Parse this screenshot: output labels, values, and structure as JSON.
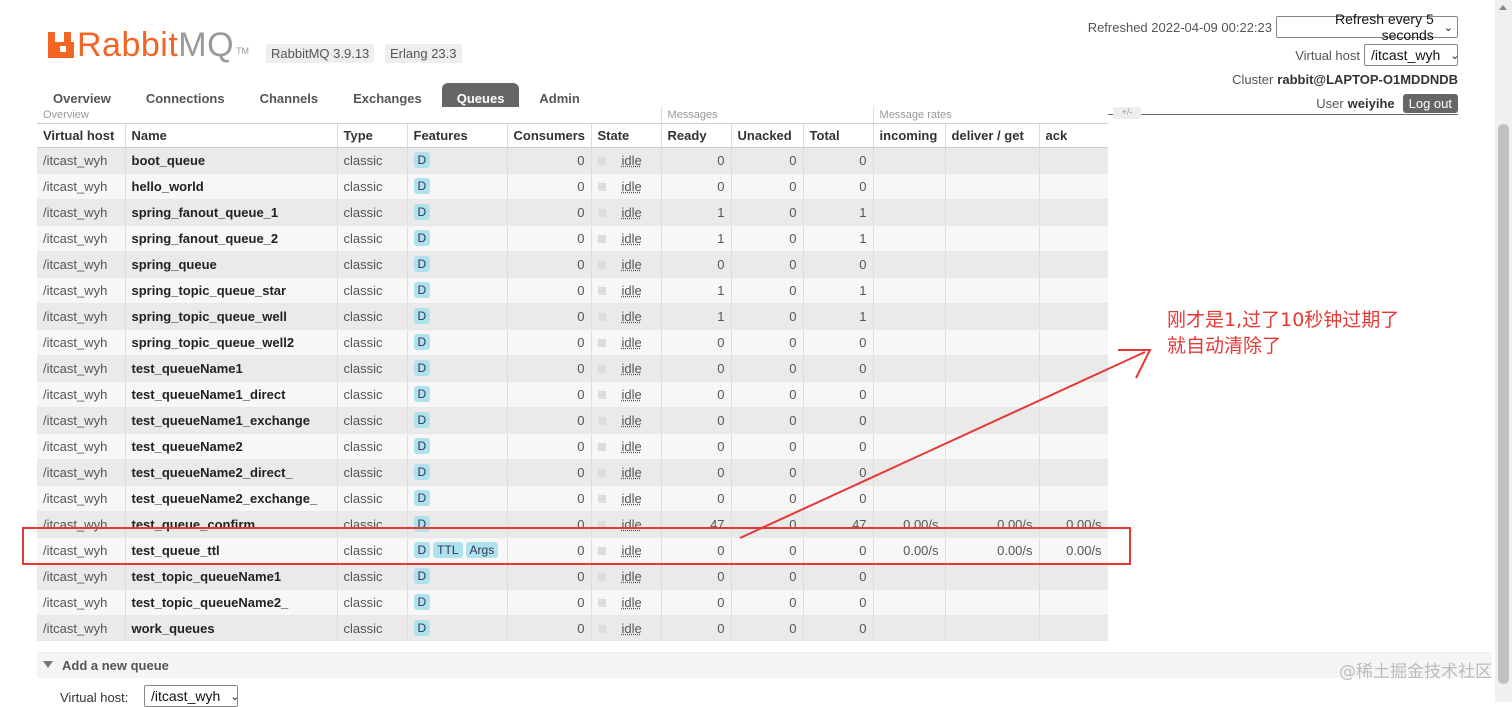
{
  "header": {
    "brand_rabbit": "Rabbit",
    "brand_mq": "MQ",
    "brand_tm": "TM",
    "rabbitmq_version": "RabbitMQ 3.9.13",
    "erlang_version": "Erlang 23.3",
    "refreshed": "Refreshed 2022-04-09 00:22:23",
    "refresh_interval": "Refresh every 5 seconds",
    "virtual_host_label": "Virtual host",
    "virtual_host_value": "/itcast_wyh",
    "cluster_label": "Cluster",
    "cluster_value": "rabbit@LAPTOP-O1MDDNDB",
    "user_label": "User",
    "user_value": "weiyihe",
    "logout_label": "Log out"
  },
  "nav": {
    "tabs": [
      {
        "label": "Overview"
      },
      {
        "label": "Connections"
      },
      {
        "label": "Channels"
      },
      {
        "label": "Exchanges"
      },
      {
        "label": "Queues",
        "active": true
      },
      {
        "label": "Admin"
      }
    ]
  },
  "table": {
    "group_headers": {
      "overview": "Overview",
      "messages": "Messages",
      "message_rates": "Message rates"
    },
    "columns": [
      "Virtual host",
      "Name",
      "Type",
      "Features",
      "Consumers",
      "State",
      "Ready",
      "Unacked",
      "Total",
      "incoming",
      "deliver / get",
      "ack"
    ],
    "rows": [
      {
        "vhost": "/itcast_wyh",
        "name": "boot_queue",
        "type": "classic",
        "features": [
          "D"
        ],
        "consumers": "0",
        "state": "idle",
        "ready": "0",
        "unacked": "0",
        "total": "0",
        "incoming": "",
        "deliver": "",
        "ack": ""
      },
      {
        "vhost": "/itcast_wyh",
        "name": "hello_world",
        "type": "classic",
        "features": [
          "D"
        ],
        "consumers": "0",
        "state": "idle",
        "ready": "0",
        "unacked": "0",
        "total": "0",
        "incoming": "",
        "deliver": "",
        "ack": ""
      },
      {
        "vhost": "/itcast_wyh",
        "name": "spring_fanout_queue_1",
        "type": "classic",
        "features": [
          "D"
        ],
        "consumers": "0",
        "state": "idle",
        "ready": "1",
        "unacked": "0",
        "total": "1",
        "incoming": "",
        "deliver": "",
        "ack": ""
      },
      {
        "vhost": "/itcast_wyh",
        "name": "spring_fanout_queue_2",
        "type": "classic",
        "features": [
          "D"
        ],
        "consumers": "0",
        "state": "idle",
        "ready": "1",
        "unacked": "0",
        "total": "1",
        "incoming": "",
        "deliver": "",
        "ack": ""
      },
      {
        "vhost": "/itcast_wyh",
        "name": "spring_queue",
        "type": "classic",
        "features": [
          "D"
        ],
        "consumers": "0",
        "state": "idle",
        "ready": "0",
        "unacked": "0",
        "total": "0",
        "incoming": "",
        "deliver": "",
        "ack": ""
      },
      {
        "vhost": "/itcast_wyh",
        "name": "spring_topic_queue_star",
        "type": "classic",
        "features": [
          "D"
        ],
        "consumers": "0",
        "state": "idle",
        "ready": "1",
        "unacked": "0",
        "total": "1",
        "incoming": "",
        "deliver": "",
        "ack": ""
      },
      {
        "vhost": "/itcast_wyh",
        "name": "spring_topic_queue_well",
        "type": "classic",
        "features": [
          "D"
        ],
        "consumers": "0",
        "state": "idle",
        "ready": "1",
        "unacked": "0",
        "total": "1",
        "incoming": "",
        "deliver": "",
        "ack": ""
      },
      {
        "vhost": "/itcast_wyh",
        "name": "spring_topic_queue_well2",
        "type": "classic",
        "features": [
          "D"
        ],
        "consumers": "0",
        "state": "idle",
        "ready": "0",
        "unacked": "0",
        "total": "0",
        "incoming": "",
        "deliver": "",
        "ack": ""
      },
      {
        "vhost": "/itcast_wyh",
        "name": "test_queueName1",
        "type": "classic",
        "features": [
          "D"
        ],
        "consumers": "0",
        "state": "idle",
        "ready": "0",
        "unacked": "0",
        "total": "0",
        "incoming": "",
        "deliver": "",
        "ack": ""
      },
      {
        "vhost": "/itcast_wyh",
        "name": "test_queueName1_direct",
        "type": "classic",
        "features": [
          "D"
        ],
        "consumers": "0",
        "state": "idle",
        "ready": "0",
        "unacked": "0",
        "total": "0",
        "incoming": "",
        "deliver": "",
        "ack": ""
      },
      {
        "vhost": "/itcast_wyh",
        "name": "test_queueName1_exchange",
        "type": "classic",
        "features": [
          "D"
        ],
        "consumers": "0",
        "state": "idle",
        "ready": "0",
        "unacked": "0",
        "total": "0",
        "incoming": "",
        "deliver": "",
        "ack": ""
      },
      {
        "vhost": "/itcast_wyh",
        "name": "test_queueName2",
        "type": "classic",
        "features": [
          "D"
        ],
        "consumers": "0",
        "state": "idle",
        "ready": "0",
        "unacked": "0",
        "total": "0",
        "incoming": "",
        "deliver": "",
        "ack": ""
      },
      {
        "vhost": "/itcast_wyh",
        "name": "test_queueName2_direct_",
        "type": "classic",
        "features": [
          "D"
        ],
        "consumers": "0",
        "state": "idle",
        "ready": "0",
        "unacked": "0",
        "total": "0",
        "incoming": "",
        "deliver": "",
        "ack": ""
      },
      {
        "vhost": "/itcast_wyh",
        "name": "test_queueName2_exchange_",
        "type": "classic",
        "features": [
          "D"
        ],
        "consumers": "0",
        "state": "idle",
        "ready": "0",
        "unacked": "0",
        "total": "0",
        "incoming": "",
        "deliver": "",
        "ack": ""
      },
      {
        "vhost": "/itcast_wyh",
        "name": "test_queue_confirm",
        "type": "classic",
        "features": [
          "D"
        ],
        "consumers": "0",
        "state": "idle",
        "ready": "47",
        "unacked": "0",
        "total": "47",
        "incoming": "0.00/s",
        "deliver": "0.00/s",
        "ack": "0.00/s"
      },
      {
        "vhost": "/itcast_wyh",
        "name": "test_queue_ttl",
        "type": "classic",
        "features": [
          "D",
          "TTL",
          "Args"
        ],
        "consumers": "0",
        "state": "idle",
        "ready": "0",
        "unacked": "0",
        "total": "0",
        "incoming": "0.00/s",
        "deliver": "0.00/s",
        "ack": "0.00/s"
      },
      {
        "vhost": "/itcast_wyh",
        "name": "test_topic_queueName1",
        "type": "classic",
        "features": [
          "D"
        ],
        "consumers": "0",
        "state": "idle",
        "ready": "0",
        "unacked": "0",
        "total": "0",
        "incoming": "",
        "deliver": "",
        "ack": ""
      },
      {
        "vhost": "/itcast_wyh",
        "name": "test_topic_queueName2_",
        "type": "classic",
        "features": [
          "D"
        ],
        "consumers": "0",
        "state": "idle",
        "ready": "0",
        "unacked": "0",
        "total": "0",
        "incoming": "",
        "deliver": "",
        "ack": ""
      },
      {
        "vhost": "/itcast_wyh",
        "name": "work_queues",
        "type": "classic",
        "features": [
          "D"
        ],
        "consumers": "0",
        "state": "idle",
        "ready": "0",
        "unacked": "0",
        "total": "0",
        "incoming": "",
        "deliver": "",
        "ack": ""
      }
    ]
  },
  "add_queue": {
    "title": "Add a new queue",
    "virtual_host_label": "Virtual host:",
    "virtual_host_value": "/itcast_wyh"
  },
  "annotation": {
    "line1": "刚才是1,过了10秒钟过期了",
    "line2": "就自动清除了",
    "color": "#e53935"
  },
  "watermark": "@稀土掘金技术社区",
  "colors": {
    "brand": "#f26522",
    "active_tab": "#666666",
    "badge": "#aee3ee"
  }
}
